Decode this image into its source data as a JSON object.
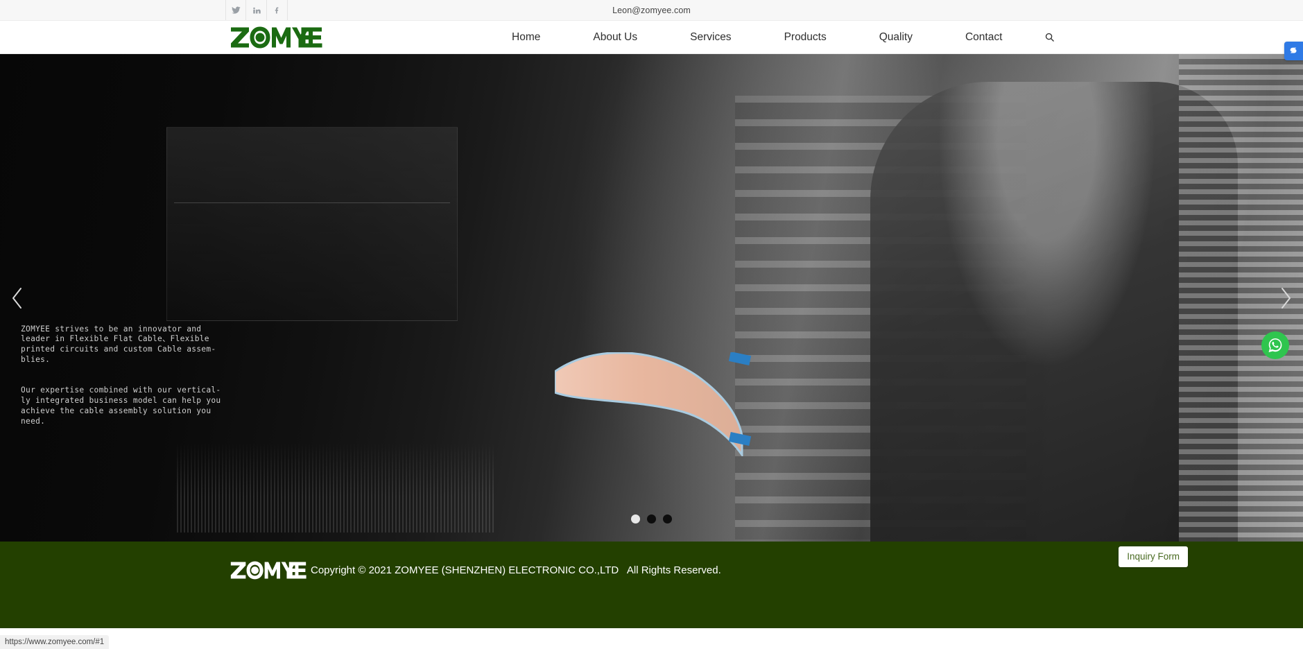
{
  "topbar": {
    "social": [
      {
        "name": "twitter-icon",
        "label": "Twitter"
      },
      {
        "name": "linkedin-icon",
        "label": "LinkedIn"
      },
      {
        "name": "facebook-icon",
        "label": "Facebook"
      }
    ],
    "email": "Leon@zomyee.com"
  },
  "header": {
    "logo_text": "ZOMYEE",
    "nav": [
      {
        "label": "Home"
      },
      {
        "label": "About Us"
      },
      {
        "label": "Services"
      },
      {
        "label": "Products"
      },
      {
        "label": "Quality"
      },
      {
        "label": "Contact"
      }
    ],
    "search_icon": "search-icon",
    "side_badge_icon": "share-badge-icon"
  },
  "hero": {
    "paragraph1": "ZOMYEE strives to be an innovator and\nleader in Flexible Flat Cable、Flexible\nprinted circuits and custom Cable assem-\nblies.",
    "paragraph2": "Our expertise combined with our vertical-\nly integrated business model can help you\nachieve the cable assembly solution you\nneed.",
    "prev_label": "‹",
    "next_label": "›",
    "slides": [
      {
        "active": true
      },
      {
        "active": false
      },
      {
        "active": false
      }
    ],
    "whatsapp_icon": "whatsapp-icon"
  },
  "footer": {
    "logo_text": "ZOMYEE",
    "copyright": "Copyright © 2021 ZOMYEE (SHENZHEN) ELECTRONIC CO.,LTD   All Rights Reserved.",
    "inquiry_label": "Inquiry Form"
  },
  "statusbar": {
    "url": "https://www.zomyee.com/#1"
  },
  "colors": {
    "brand_green": "#1b6b12",
    "footer_green": "#234000",
    "accent_blue": "#2f7ae5",
    "whatsapp_green": "#2fc54e"
  }
}
